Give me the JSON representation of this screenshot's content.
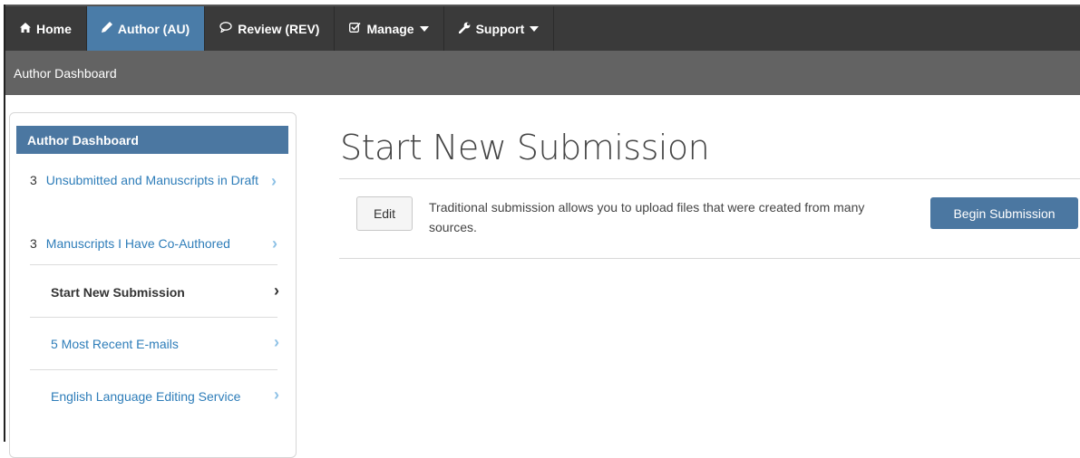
{
  "topnav": {
    "items": [
      {
        "label": "Home",
        "icon": "home-icon"
      },
      {
        "label": "Author (AU)",
        "icon": "pencil-icon",
        "active": true
      },
      {
        "label": "Review (REV)",
        "icon": "comment-icon"
      },
      {
        "label": "Manage",
        "icon": "check-square-icon",
        "dropdown": true
      },
      {
        "label": "Support",
        "icon": "wrench-icon",
        "dropdown": true
      }
    ]
  },
  "subnav": {
    "label": "Author Dashboard"
  },
  "sidebar": {
    "header": "Author Dashboard",
    "items": [
      {
        "count": "3",
        "label": "Unsubmitted and Manuscripts in Draft"
      },
      {
        "count": "3",
        "label": "Manuscripts I Have Co-Authored"
      },
      {
        "count": "",
        "label": "Start New Submission",
        "active": true
      },
      {
        "count": "",
        "label": "5 Most Recent E-mails"
      },
      {
        "count": "",
        "label": "English Language Editing Service"
      }
    ]
  },
  "main": {
    "title": "Start New Submission",
    "edit_label": "Edit",
    "description": "Traditional submission allows you to upload files that were created from many sources.",
    "begin_label": "Begin Submission"
  },
  "colors": {
    "nav_bg": "#3a3a3a",
    "nav_active": "#4a7ca8",
    "subnav_bg": "#636363",
    "accent": "#4b77a1",
    "link": "#2e7db9"
  }
}
